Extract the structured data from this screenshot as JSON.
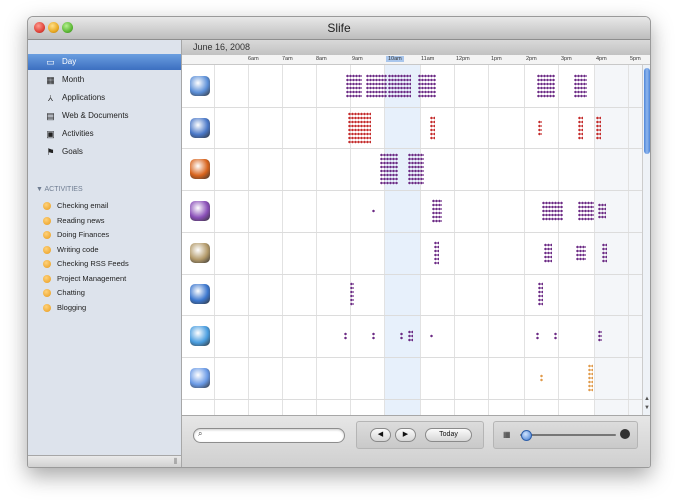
{
  "window": {
    "title": "Slife"
  },
  "sidebar": {
    "items": [
      {
        "label": "Day",
        "icon": "day-calendar-icon",
        "glyph": "▭",
        "selected": true
      },
      {
        "label": "Month",
        "icon": "month-calendar-icon",
        "glyph": "▦",
        "selected": false
      },
      {
        "label": "Applications",
        "icon": "applications-icon",
        "glyph": "⩑",
        "selected": false
      },
      {
        "label": "Web & Documents",
        "icon": "web-documents-icon",
        "glyph": "▤",
        "selected": false
      },
      {
        "label": "Activities",
        "icon": "activities-icon",
        "glyph": "▣",
        "selected": false
      },
      {
        "label": "Goals",
        "icon": "goals-flag-icon",
        "glyph": "⚑",
        "selected": false
      }
    ],
    "activities_header": "ACTIVITIES",
    "activities": [
      "Checking email",
      "Reading news",
      "Doing Finances",
      "Writing code",
      "Checking RSS Feeds",
      "Project Management",
      "Chatting",
      "Blogging"
    ]
  },
  "main": {
    "date": "June 16, 2008",
    "hours": [
      "6am",
      "7am",
      "8am",
      "9am",
      "10am",
      "11am",
      "12pm",
      "1pm",
      "2pm",
      "3pm",
      "4pm",
      "5pm"
    ],
    "highlighted_hour": "10am",
    "apps": [
      {
        "icon": "safari-icon",
        "color": "#5b8fd8",
        "dot_color": "#6b2a84"
      },
      {
        "icon": "preview-icon",
        "color": "#4a78c8",
        "dot_color": "#c42b2b"
      },
      {
        "icon": "firefox-icon",
        "color": "#d8641d",
        "dot_color": "#6b2a84"
      },
      {
        "icon": "textmate-icon",
        "color": "#8a4fb8",
        "dot_color": "#6b2a84"
      },
      {
        "icon": "mail-icon",
        "color": "#b39a6a",
        "dot_color": "#6b2a84"
      },
      {
        "icon": "netnewswire-icon",
        "color": "#3d78cf",
        "dot_color": "#6b2a84"
      },
      {
        "icon": "twitterrific-icon",
        "color": "#4a9ee0",
        "dot_color": "#6b2a84"
      },
      {
        "icon": "ichat-icon",
        "color": "#6a9ae6",
        "dot_color": "#e09a4a"
      }
    ]
  },
  "toolbar": {
    "search_placeholder": "",
    "search_value": "",
    "prev_label": "◀",
    "next_label": "▶",
    "today_label": "Today",
    "zoom_level": 0.06
  }
}
